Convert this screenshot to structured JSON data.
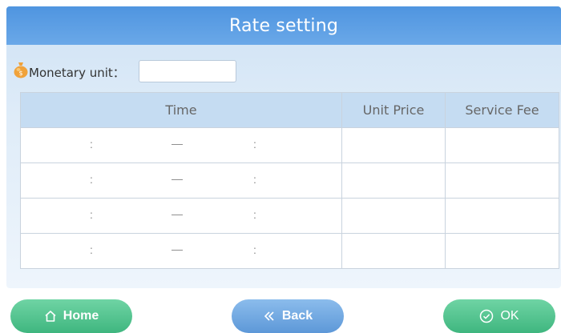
{
  "header": {
    "title": "Rate setting"
  },
  "monetary": {
    "label": "Monetary unit：",
    "value": "",
    "icon": "money-bag-icon"
  },
  "table": {
    "columns": [
      "Time",
      "Unit Price",
      "Service Fee"
    ],
    "rows": [
      {
        "start_sep": ":",
        "range_dash": "—",
        "end_sep": ":",
        "unit_price": "",
        "service_fee": ""
      },
      {
        "start_sep": ":",
        "range_dash": "—",
        "end_sep": ":",
        "unit_price": "",
        "service_fee": ""
      },
      {
        "start_sep": ":",
        "range_dash": "—",
        "end_sep": ":",
        "unit_price": "",
        "service_fee": ""
      },
      {
        "start_sep": ":",
        "range_dash": "—",
        "end_sep": ":",
        "unit_price": "",
        "service_fee": ""
      }
    ]
  },
  "buttons": {
    "home": {
      "label": "Home",
      "icon": "home-icon"
    },
    "back": {
      "label": "Back",
      "icon": "double-chevron-left-icon"
    },
    "ok": {
      "label": "OK",
      "icon": "check-circle-icon"
    }
  },
  "colors": {
    "title_bar": "#5a9de3",
    "table_header": "#c5dcf2",
    "green_button": "#4cc08a",
    "blue_button": "#6aa4e0"
  }
}
